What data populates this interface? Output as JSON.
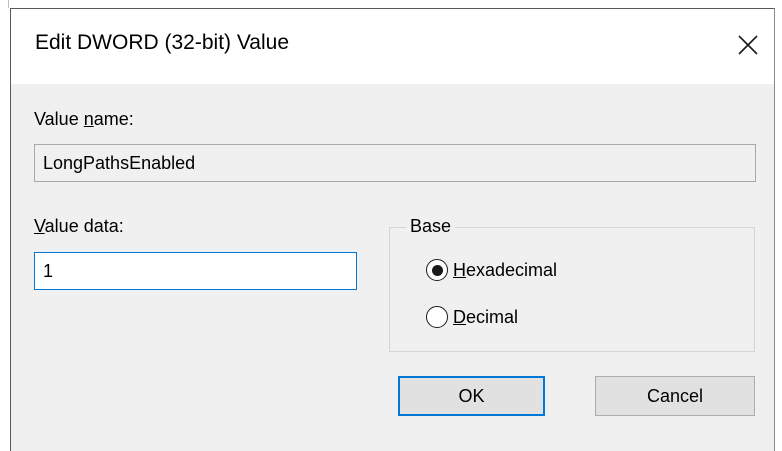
{
  "dialog": {
    "title": "Edit DWORD (32-bit) Value",
    "close_icon": "close-icon"
  },
  "value_name": {
    "label_accel": "V",
    "label_mid": "alue ",
    "label_underlined": "n",
    "label_end": "ame:",
    "value": "LongPathsEnabled"
  },
  "value_data": {
    "label_underlined": "V",
    "label_rest": "alue data:",
    "value": "1"
  },
  "base": {
    "legend": "Base",
    "options": [
      {
        "accel": "H",
        "rest": "exadecimal",
        "selected": true
      },
      {
        "accel": "D",
        "rest": "ecimal",
        "selected": false
      }
    ]
  },
  "buttons": {
    "ok_label": "OK",
    "cancel_label": "Cancel"
  }
}
